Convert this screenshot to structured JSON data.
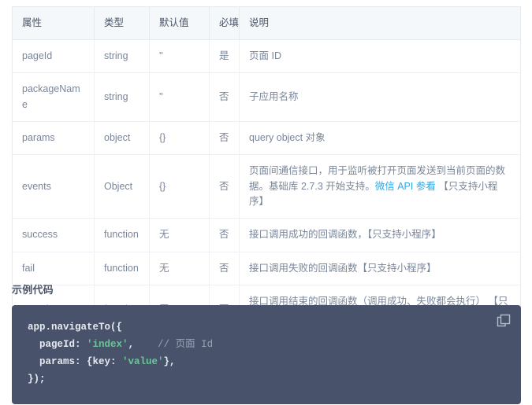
{
  "table": {
    "columns": [
      "属性",
      "类型",
      "默认值",
      "必填",
      "说明"
    ],
    "rows": [
      {
        "attr": "pageId",
        "type": "string",
        "default": "''",
        "required": "是",
        "desc": "页面 ID"
      },
      {
        "attr": "packageName",
        "type": "string",
        "default": "''",
        "required": "否",
        "desc": "子应用名称"
      },
      {
        "attr": "params",
        "type": "object",
        "default": "{}",
        "required": "否",
        "desc": "query object 对象"
      },
      {
        "attr": "events",
        "type": "Object",
        "default": "{}",
        "required": "否",
        "desc_before": "页面间通信接口，用于监听被打开页面发送到当前页面的数据。基础库 2.7.3 开始支持。",
        "desc_link": "微信 API 参看",
        "desc_after": " 【只支持小程序】"
      },
      {
        "attr": "success",
        "type": "function",
        "default": "无",
        "required": "否",
        "desc": "接口调用成功的回调函数，【只支持小程序】"
      },
      {
        "attr": "fail",
        "type": "function",
        "default": "无",
        "required": "否",
        "desc": "接口调用失败的回调函数【只支持小程序】"
      },
      {
        "attr": "complete",
        "type": "function",
        "default": "无",
        "required": "否",
        "desc": "接口调用结束的回调函数（调用成功、失败都会执行） 【只支持小程序】"
      }
    ]
  },
  "example": {
    "heading": "示例代码",
    "copy_icon": "copy-icon",
    "code": {
      "line1": "app.navigateTo({",
      "line2_key": "  pageId: ",
      "line2_str": "'index'",
      "line2_after": ",",
      "line2_comment": "// 页面 Id",
      "line3_key": "  params: {key: ",
      "line3_str": "'value'",
      "line3_after": "},",
      "line4": "});"
    }
  },
  "colors": {
    "link": "#2fa8e8",
    "code_bg": "#48536b",
    "string": "#6cc49a",
    "header_bg": "#f5f8fa"
  }
}
